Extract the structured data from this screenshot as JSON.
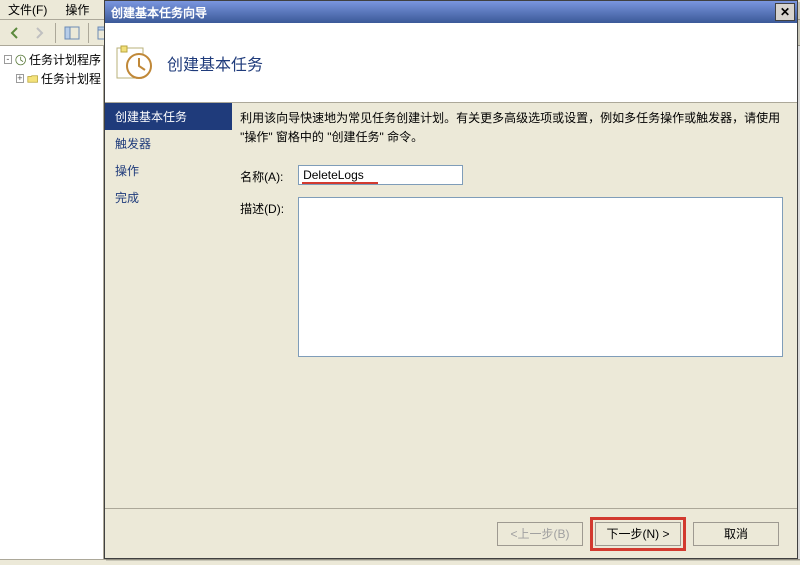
{
  "menu": {
    "file": "文件(F)",
    "action": "操作"
  },
  "tree": {
    "root": "任务计划程序",
    "child": "任务计划程"
  },
  "wizard": {
    "title": "创建基本任务向导",
    "banner_title": "创建基本任务",
    "steps": {
      "create": "创建基本任务",
      "trigger": "触发器",
      "action": "操作",
      "finish": "完成"
    },
    "help_text": "利用该向导快速地为常见任务创建计划。有关更多高级选项或设置，例如多任务操作或触发器，请使用 \"操作\" 窗格中的 \"创建任务\" 命令。",
    "name_label": "名称(A):",
    "name_value": "DeleteLogs",
    "desc_label": "描述(D):",
    "desc_value": "",
    "buttons": {
      "back": "<上一步(B)",
      "next": "下一步(N) >",
      "cancel": "取消"
    }
  }
}
